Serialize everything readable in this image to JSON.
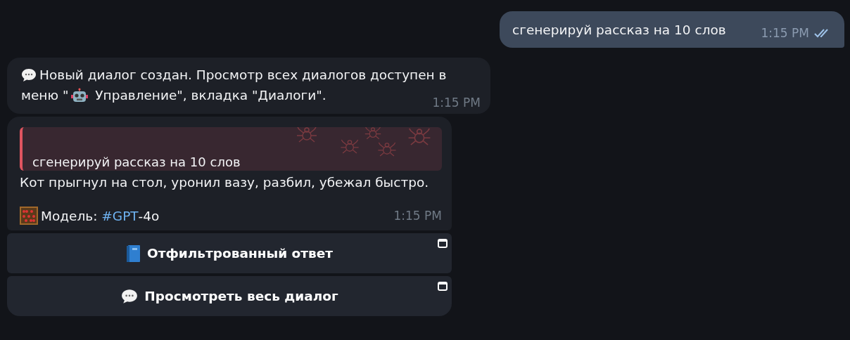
{
  "outgoing": {
    "text": "сгенерируй рассказ на 10 слов",
    "time": "1:15 PM",
    "read": true
  },
  "notice": {
    "text_line1": "Новый диалог создан. Просмотр всех диалогов доступен в",
    "text_before": "меню \"",
    "text_after": " Управление\", вкладка \"Диалоги\".",
    "time": "1:15 PM"
  },
  "reply": {
    "quote": "сгенерируй рассказ на 10 слов",
    "text": "Кот прыгнул на стол, уронил вазу, разбил, убежал быстро.",
    "model_label": "Модель: ",
    "model_tag": "#GPT",
    "model_suffix": "-4o",
    "time": "1:15 PM"
  },
  "buttons": [
    {
      "label": "Отфильтрованный ответ"
    },
    {
      "label": "Просмотреть весь диалог"
    }
  ]
}
